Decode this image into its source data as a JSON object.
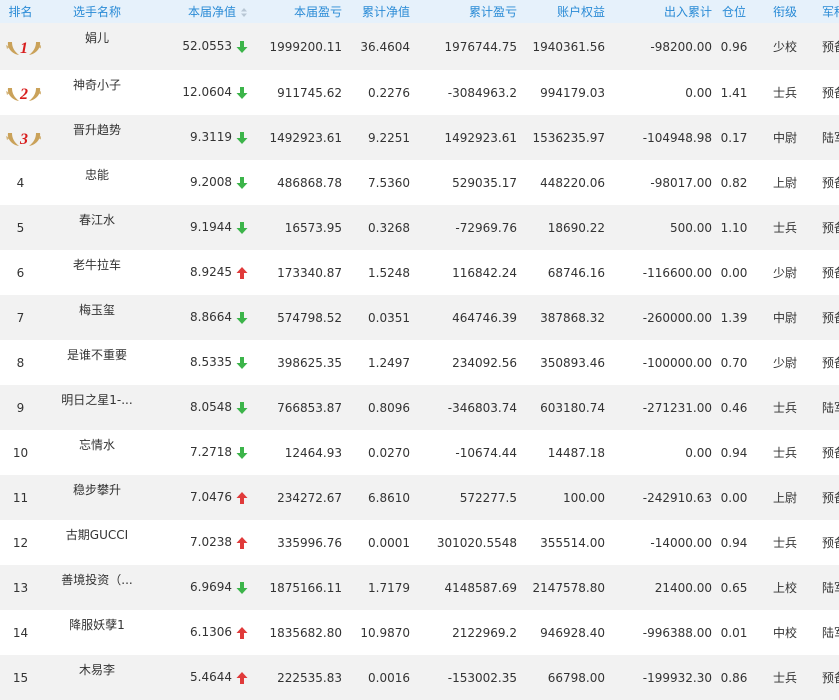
{
  "colors": {
    "header_bg": "#e6f1fb",
    "header_text": "#2a8bd6",
    "row_alt": "#f2f2f2",
    "up": "#e03a3a",
    "down": "#3cb44a",
    "medal_gold": "#caa25a",
    "medal_number": "#d81e1e"
  },
  "headers": {
    "rank": "排名",
    "name": "选手名称",
    "nav": "本届净值",
    "pnl": "本届盈亏",
    "cum_nav": "累计净值",
    "cum_pnl": "累计盈亏",
    "equity": "账户权益",
    "flow": "出入累计",
    "position": "仓位",
    "grade": "衔级",
    "branch": "军种"
  },
  "rows": [
    {
      "rank": "1",
      "name": "娟儿",
      "nav": "52.0553",
      "trend": "down",
      "pnl": "1999200.11",
      "cum_nav": "36.4604",
      "cum_pnl": "1976744.75",
      "equity": "1940361.56",
      "flow": "-98200.00",
      "position": "0.96",
      "grade": "少校",
      "branch": "预备役"
    },
    {
      "rank": "2",
      "name": "神奇小子",
      "nav": "12.0604",
      "trend": "down",
      "pnl": "911745.62",
      "cum_nav": "0.2276",
      "cum_pnl": "-3084963.2",
      "equity": "994179.03",
      "flow": "0.00",
      "position": "1.41",
      "grade": "士兵",
      "branch": "预备役"
    },
    {
      "rank": "3",
      "name": "晋升趋势",
      "nav": "9.3119",
      "trend": "down",
      "pnl": "1492923.61",
      "cum_nav": "9.2251",
      "cum_pnl": "1492923.61",
      "equity": "1536235.97",
      "flow": "-104948.98",
      "position": "0.17",
      "grade": "中尉",
      "branch": "陆军"
    },
    {
      "rank": "4",
      "name": "忠能",
      "nav": "9.2008",
      "trend": "down",
      "pnl": "486868.78",
      "cum_nav": "7.5360",
      "cum_pnl": "529035.17",
      "equity": "448220.06",
      "flow": "-98017.00",
      "position": "0.82",
      "grade": "上尉",
      "branch": "预备役"
    },
    {
      "rank": "5",
      "name": "春江水",
      "nav": "9.1944",
      "trend": "down",
      "pnl": "16573.95",
      "cum_nav": "0.3268",
      "cum_pnl": "-72969.76",
      "equity": "18690.22",
      "flow": "500.00",
      "position": "1.10",
      "grade": "士兵",
      "branch": "预备役"
    },
    {
      "rank": "6",
      "name": "老牛拉车",
      "nav": "8.9245",
      "trend": "up",
      "pnl": "173340.87",
      "cum_nav": "1.5248",
      "cum_pnl": "116842.24",
      "equity": "68746.16",
      "flow": "-116600.00",
      "position": "0.00",
      "grade": "少尉",
      "branch": "预备役"
    },
    {
      "rank": "7",
      "name": "梅玉玺",
      "nav": "8.8664",
      "trend": "down",
      "pnl": "574798.52",
      "cum_nav": "0.0351",
      "cum_pnl": "464746.39",
      "equity": "387868.32",
      "flow": "-260000.00",
      "position": "1.39",
      "grade": "中尉",
      "branch": "预备役"
    },
    {
      "rank": "8",
      "name": "是谁不重要",
      "nav": "8.5335",
      "trend": "down",
      "pnl": "398625.35",
      "cum_nav": "1.2497",
      "cum_pnl": "234092.56",
      "equity": "350893.46",
      "flow": "-100000.00",
      "position": "0.70",
      "grade": "少尉",
      "branch": "预备役"
    },
    {
      "rank": "9",
      "name": "明日之星1-...",
      "nav": "8.0548",
      "trend": "down",
      "pnl": "766853.87",
      "cum_nav": "0.8096",
      "cum_pnl": "-346803.74",
      "equity": "603180.74",
      "flow": "-271231.00",
      "position": "0.46",
      "grade": "士兵",
      "branch": "陆军"
    },
    {
      "rank": "10",
      "name": "忘情水",
      "nav": "7.2718",
      "trend": "down",
      "pnl": "12464.93",
      "cum_nav": "0.0270",
      "cum_pnl": "-10674.44",
      "equity": "14487.18",
      "flow": "0.00",
      "position": "0.94",
      "grade": "士兵",
      "branch": "预备役"
    },
    {
      "rank": "11",
      "name": "稳步攀升",
      "nav": "7.0476",
      "trend": "up",
      "pnl": "234272.67",
      "cum_nav": "6.8610",
      "cum_pnl": "572277.5",
      "equity": "100.00",
      "flow": "-242910.63",
      "position": "0.00",
      "grade": "上尉",
      "branch": "预备役"
    },
    {
      "rank": "12",
      "name": "古期GUCCI",
      "nav": "7.0238",
      "trend": "up",
      "pnl": "335996.76",
      "cum_nav": "0.0001",
      "cum_pnl": "301020.5548",
      "equity": "355514.00",
      "flow": "-14000.00",
      "position": "0.94",
      "grade": "士兵",
      "branch": "预备役"
    },
    {
      "rank": "13",
      "name": "善境投资（...",
      "nav": "6.9694",
      "trend": "down",
      "pnl": "1875166.11",
      "cum_nav": "1.7179",
      "cum_pnl": "4148587.69",
      "equity": "2147578.80",
      "flow": "21400.00",
      "position": "0.65",
      "grade": "上校",
      "branch": "陆军"
    },
    {
      "rank": "14",
      "name": "降服妖孽1",
      "nav": "6.1306",
      "trend": "up",
      "pnl": "1835682.80",
      "cum_nav": "10.9870",
      "cum_pnl": "2122969.2",
      "equity": "946928.40",
      "flow": "-996388.00",
      "position": "0.01",
      "grade": "中校",
      "branch": "陆军"
    },
    {
      "rank": "15",
      "name": "木易李",
      "nav": "5.4644",
      "trend": "up",
      "pnl": "222535.83",
      "cum_nav": "0.0016",
      "cum_pnl": "-153002.35",
      "equity": "66798.00",
      "flow": "-199932.30",
      "position": "0.86",
      "grade": "士兵",
      "branch": "预备役"
    }
  ]
}
